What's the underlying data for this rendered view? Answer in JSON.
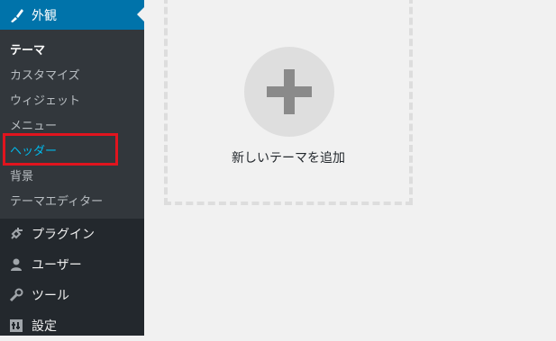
{
  "sidebar": {
    "active_menu": {
      "label": "外観",
      "icon": "paintbrush-icon"
    },
    "submenu": [
      {
        "label": "テーマ",
        "state": "current"
      },
      {
        "label": "カスタマイズ",
        "state": "normal"
      },
      {
        "label": "ウィジェット",
        "state": "normal"
      },
      {
        "label": "メニュー",
        "state": "normal"
      },
      {
        "label": "ヘッダー",
        "state": "highlighted"
      },
      {
        "label": "背景",
        "state": "normal"
      },
      {
        "label": "テーマエディター",
        "state": "normal"
      }
    ],
    "menu_items": [
      {
        "label": "プラグイン",
        "icon": "plugin-icon"
      },
      {
        "label": "ユーザー",
        "icon": "user-icon"
      },
      {
        "label": "ツール",
        "icon": "wrench-icon"
      },
      {
        "label": "設定",
        "icon": "settings-icon"
      }
    ]
  },
  "main": {
    "add_theme_label": "新しいテーマを追加"
  },
  "colors": {
    "sidebar_bg": "#23282d",
    "submenu_bg": "#32373c",
    "active_bg": "#0073aa",
    "highlight_text": "#00b9eb",
    "annotation_red": "#e1141e",
    "content_bg": "#f1f1f1"
  }
}
